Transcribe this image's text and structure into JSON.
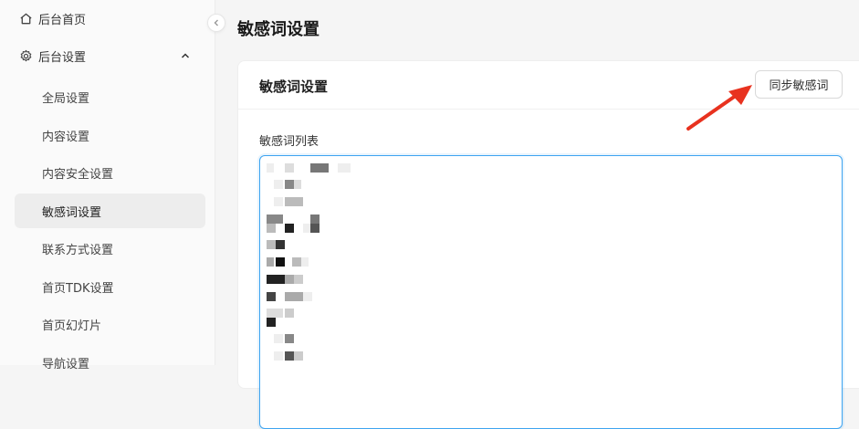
{
  "sidebar": {
    "home_label": "后台首页",
    "group_label": "后台设置",
    "sub_items": [
      {
        "label": "全局设置"
      },
      {
        "label": "内容设置"
      },
      {
        "label": "内容安全设置"
      },
      {
        "label": "敏感词设置"
      },
      {
        "label": "联系方式设置"
      },
      {
        "label": "首页TDK设置"
      },
      {
        "label": "首页幻灯片"
      },
      {
        "label": "导航设置"
      }
    ],
    "active_item": "敏感词设置"
  },
  "main": {
    "page_title": "敏感词设置",
    "card_title": "敏感词设置",
    "sync_button_label": "同步敏感词",
    "field_label": "敏感词列表"
  },
  "icons": {
    "home": "home-icon",
    "settings": "gear-icon",
    "expand": "chevron-up-icon",
    "collapse": "chevron-left-icon",
    "annotation": "red-arrow-icon"
  },
  "colors": {
    "accent_border": "#3ea4f0",
    "active_bg": "#ededed",
    "annotation_arrow": "#e8321f"
  }
}
